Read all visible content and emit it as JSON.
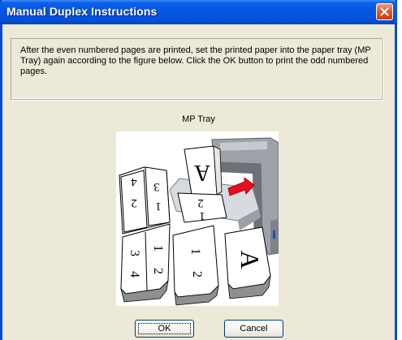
{
  "window": {
    "title": "Manual Duplex Instructions"
  },
  "message": {
    "text": "After the even numbered pages are printed, set the printed paper into the paper tray (MP Tray) again according to the figure below. Click the OK button to print the odd numbered pages."
  },
  "figure": {
    "label": "MP Tray",
    "page_numbers": [
      "4",
      "3",
      "2",
      "1",
      "2",
      "1",
      "3",
      "4",
      "1",
      "2",
      "1",
      "2",
      "A",
      "A"
    ]
  },
  "buttons": {
    "ok": "OK",
    "cancel": "Cancel"
  },
  "colors": {
    "titlebar": "#0554e2",
    "dialog_bg": "#ece9d8",
    "close_button": "#e45a2b",
    "arrow": "#e8101a"
  },
  "icons": {
    "close": "close-icon"
  }
}
